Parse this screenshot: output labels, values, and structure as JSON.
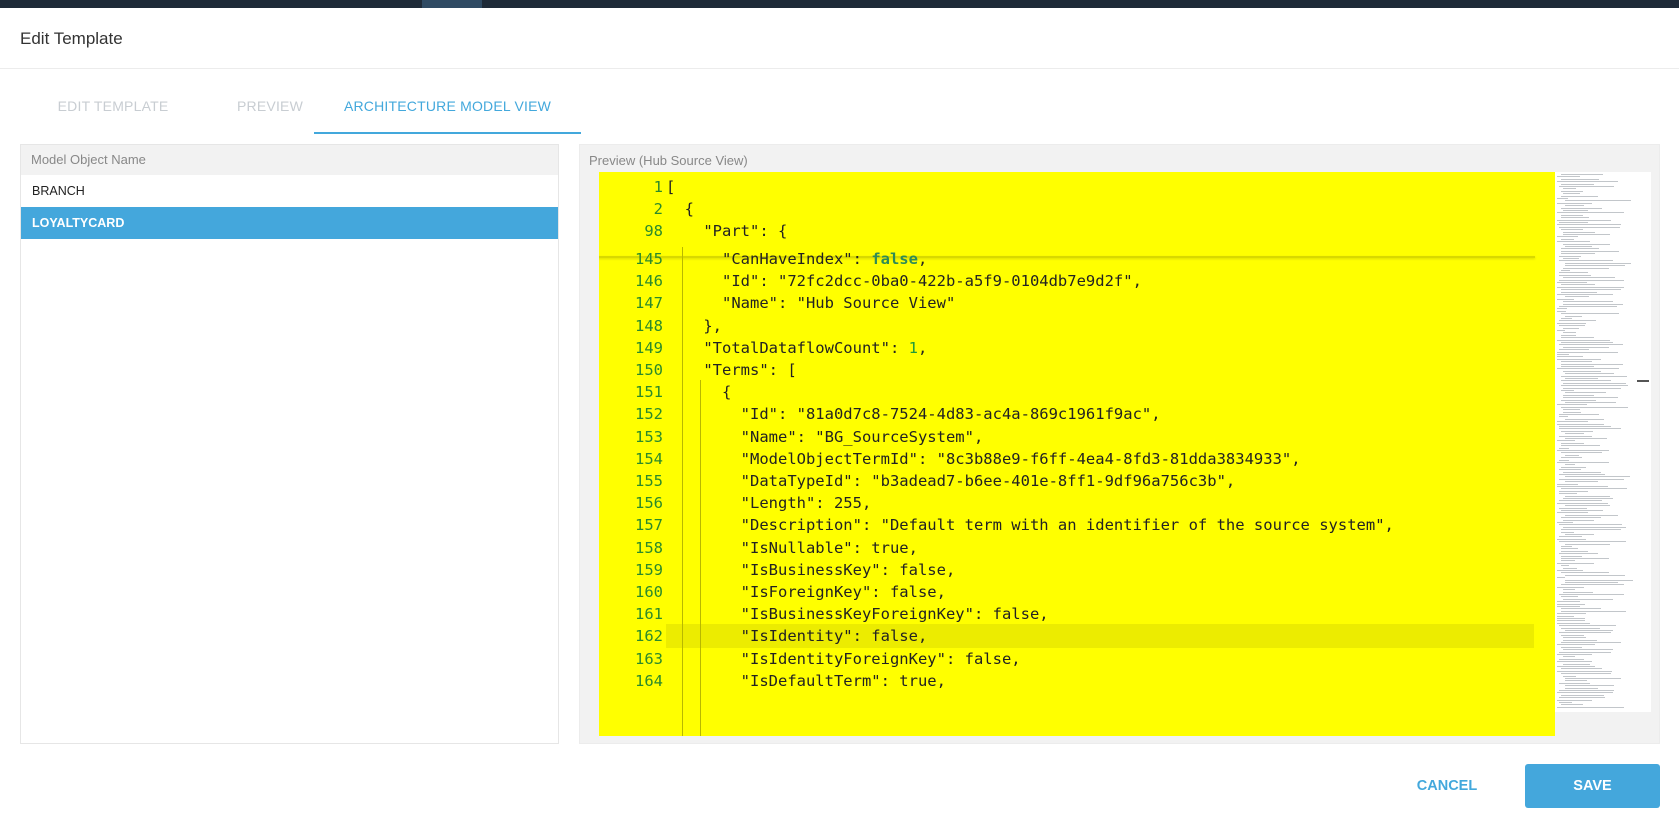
{
  "header": {
    "title": "Edit Template"
  },
  "tabs": [
    {
      "label": "EDIT TEMPLATE",
      "active": false
    },
    {
      "label": "PREVIEW",
      "active": false
    },
    {
      "label": "ARCHITECTURE MODEL VIEW",
      "active": true
    }
  ],
  "model_objects": {
    "column_header": "Model Object Name",
    "rows": [
      {
        "label": "BRANCH",
        "selected": false
      },
      {
        "label": "LOYALTYCARD",
        "selected": true
      }
    ]
  },
  "preview": {
    "label": "Preview (Hub Source View)",
    "sticky_lines": [
      {
        "num": "1",
        "text": "["
      },
      {
        "num": "2",
        "text": "  {"
      },
      {
        "num": "98",
        "text": "    \"Part\": {"
      }
    ],
    "lines": [
      {
        "num": "145",
        "pre": "      \"CanHaveIndex\": ",
        "kw": "false",
        "post": ","
      },
      {
        "num": "146",
        "text": "      \"Id\": \"72fc2dcc-0ba0-422b-a5f9-0104db7e9d2f\","
      },
      {
        "num": "147",
        "text": "      \"Name\": \"Hub Source View\""
      },
      {
        "num": "148",
        "text": "    },"
      },
      {
        "num": "149",
        "pre": "    \"TotalDataflowCount\": ",
        "nm": "1",
        "post": ","
      },
      {
        "num": "150",
        "text": "    \"Terms\": ["
      },
      {
        "num": "151",
        "text": "      {"
      },
      {
        "num": "152",
        "text": "        \"Id\": \"81a0d7c8-7524-4d83-ac4a-869c1961f9ac\","
      },
      {
        "num": "153",
        "text": "        \"Name\": \"BG_SourceSystem\","
      },
      {
        "num": "154",
        "text": "        \"ModelObjectTermId\": \"8c3b88e9-f6ff-4ea4-8fd3-81dda3834933\","
      },
      {
        "num": "155",
        "text": "        \"DataTypeId\": \"b3adead7-b6ee-401e-8ff1-9df96a756c3b\","
      },
      {
        "num": "156",
        "text": "        \"Length\": 255,"
      },
      {
        "num": "157",
        "text": "        \"Description\": \"Default term with an identifier of the source system\","
      },
      {
        "num": "158",
        "text": "        \"IsNullable\": true,"
      },
      {
        "num": "159",
        "text": "        \"IsBusinessKey\": false,"
      },
      {
        "num": "160",
        "text": "        \"IsForeignKey\": false,"
      },
      {
        "num": "161",
        "text": "        \"IsBusinessKeyForeignKey\": false,"
      },
      {
        "num": "162",
        "text": "        \"IsIdentity\": false,"
      },
      {
        "num": "163",
        "text": "        \"IsIdentityForeignKey\": false,"
      },
      {
        "num": "164",
        "text": "        \"IsDefaultTerm\": true,"
      }
    ],
    "current_line": "162"
  },
  "footer": {
    "cancel_label": "CANCEL",
    "save_label": "SAVE"
  },
  "colors": {
    "accent": "#44a7dc",
    "editor_bg": "#ffff00",
    "line_number": "#2b8a2b"
  }
}
